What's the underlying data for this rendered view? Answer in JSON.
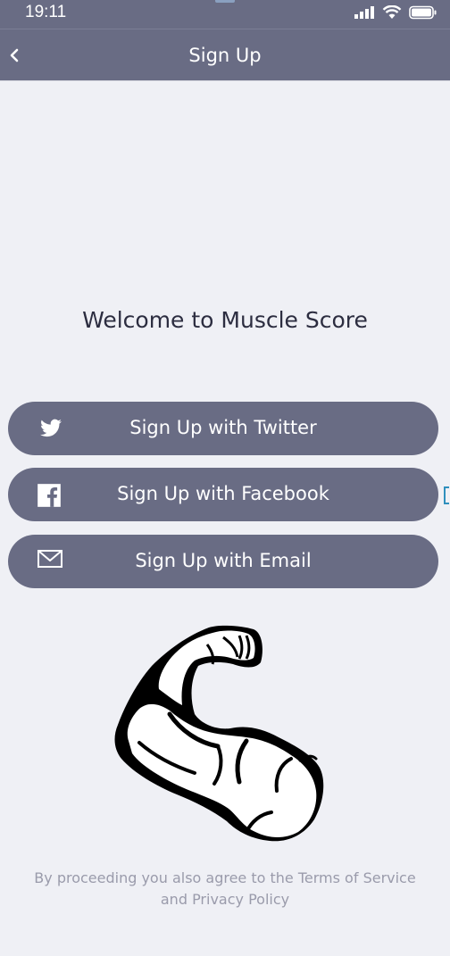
{
  "status_bar": {
    "time": "19:11",
    "icons": [
      "signal-icon",
      "wifi-icon",
      "battery-icon"
    ]
  },
  "nav": {
    "title": "Sign Up",
    "back_icon": "chevron-left-icon"
  },
  "welcome_text": "Welcome to Muscle Score",
  "buttons": {
    "twitter": {
      "label": "Sign Up with Twitter",
      "icon": "twitter-icon"
    },
    "facebook": {
      "label": "Sign Up with Facebook",
      "icon": "facebook-icon"
    },
    "email": {
      "label": "Sign Up with Email",
      "icon": "envelope-icon"
    }
  },
  "illustration": {
    "icon": "flexed-arm-icon"
  },
  "terms": {
    "line1": "By proceeding you also agree to the Terms of Service",
    "line2": "and Privacy Policy"
  },
  "colors": {
    "primary": "#696c84",
    "background": "#eff0f5",
    "muted_text": "#9a9bab",
    "heading_text": "#2c2d40"
  }
}
